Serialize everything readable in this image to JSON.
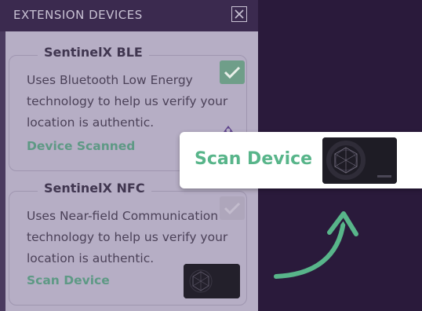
{
  "panel": {
    "title": "EXTENSION DEVICES"
  },
  "devices": [
    {
      "name": "SentinelX BLE",
      "description": "Uses Bluetooth Low Energy technology to help us verify your location is authentic.",
      "status": "Device Scanned",
      "checked": true
    },
    {
      "name": "SentinelX NFC",
      "description": "Uses Near-field Communication technology to help us verify your location is authentic.",
      "status": "Scan Device",
      "checked": false
    }
  ],
  "callout": {
    "label": "Scan Device"
  },
  "colors": {
    "background": "#2a1a3b",
    "accent_green": "#58b58a",
    "card_dark": "#1c1a22"
  },
  "icons": {
    "close": "close-icon",
    "check": "checkmark-icon",
    "arrow": "curved-arrow-icon",
    "nfc_card": "nfc-card-image"
  }
}
